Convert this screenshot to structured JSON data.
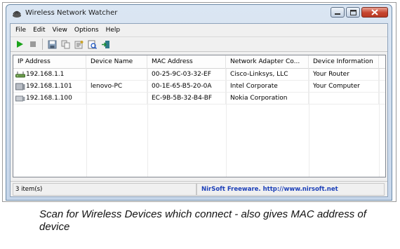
{
  "window": {
    "title": "Wireless Network Watcher"
  },
  "menu": [
    "File",
    "Edit",
    "View",
    "Options",
    "Help"
  ],
  "toolbar": {
    "buttons": [
      "start-scan-icon",
      "stop-scan-icon",
      "save-icon",
      "copy-icon",
      "properties-icon",
      "html-report-icon",
      "exit-icon"
    ]
  },
  "table": {
    "columns": [
      "IP Address",
      "Device Name",
      "MAC Address",
      "Network Adapter Co...",
      "Device Information"
    ],
    "rows": [
      {
        "ip": "192.168.1.1",
        "name": "",
        "mac": "00-25-9C-03-32-EF",
        "adapter": "Cisco-Linksys, LLC",
        "info": "Your Router",
        "icon": "router-icon"
      },
      {
        "ip": "192.168.1.101",
        "name": "lenovo-PC",
        "mac": "00-1E-65-B5-20-0A",
        "adapter": "Intel Corporate",
        "info": "Your Computer",
        "icon": "computer-icon"
      },
      {
        "ip": "192.168.1.100",
        "name": "",
        "mac": "EC-9B-5B-32-B4-BF",
        "adapter": "Nokia Corporation",
        "info": "",
        "icon": "device-icon"
      }
    ]
  },
  "status": {
    "count": "3 item(s)",
    "link": "NirSoft Freeware.  http://www.nirsoft.net"
  },
  "caption": "Scan for Wireless Devices which connect - also gives MAC address of device",
  "colors": {
    "link": "#1b3fb8",
    "play": "#1aa31a",
    "close": "#c6452f"
  }
}
